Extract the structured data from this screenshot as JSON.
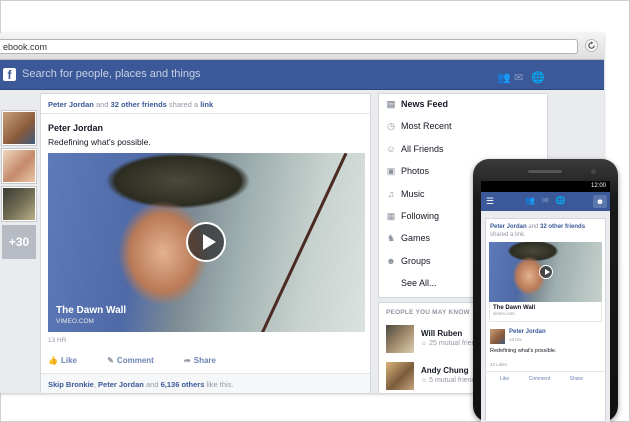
{
  "browser": {
    "url": "ebook.com",
    "reload_icon": "reload-icon"
  },
  "fb_bar": {
    "logo": "f",
    "search_placeholder": "Search for people, places and things",
    "icons": [
      "friend-requests-icon",
      "messages-icon",
      "notifications-icon"
    ],
    "color": "#3b5998"
  },
  "left_rail": {
    "more_count": "+30"
  },
  "story": {
    "header_actor": "Peter Jordan",
    "header_and": "and",
    "header_friends": "32 other friends",
    "header_action": "shared a",
    "header_link": "link",
    "author": "Peter Jordan",
    "text": "Redefining what's possible.",
    "video_title": "The Dawn Wall",
    "video_source": "VIMEO.COM",
    "time": "13 HR",
    "actions": [
      "Like",
      "Comment",
      "Share"
    ],
    "likes_name1": "Skip Bronkie",
    "likes_name2": "Peter Jordan",
    "likes_others": "6,136 others",
    "likes_suffix": "like this."
  },
  "nav": {
    "items": [
      {
        "label": "News Feed",
        "icon": "news-feed-icon"
      },
      {
        "label": "Most Recent",
        "icon": "clock-icon"
      },
      {
        "label": "All Friends",
        "icon": "friends-icon"
      },
      {
        "label": "Photos",
        "icon": "photos-icon"
      },
      {
        "label": "Music",
        "icon": "music-icon"
      },
      {
        "label": "Following",
        "icon": "following-icon"
      },
      {
        "label": "Games",
        "icon": "games-icon"
      },
      {
        "label": "Groups",
        "icon": "groups-icon"
      },
      {
        "label": "See All...",
        "icon": ""
      }
    ]
  },
  "pymk": {
    "title": "PEOPLE YOU MAY KNOW",
    "people": [
      {
        "name": "Will Ruben",
        "mutual": "25 mutual friends"
      },
      {
        "name": "Andy Chung",
        "mutual": "5 mutual friends"
      }
    ]
  },
  "phone": {
    "status": "12:00",
    "header_actor": "Peter Jordan",
    "header_and": "and",
    "header_friends": "32 other friends",
    "header_action": "shared a link.",
    "link_title": "The Dawn Wall",
    "link_source": "vimeo.com",
    "author": "Peter Jordan",
    "time": "13 hrs",
    "text": "Redefining what's possible.",
    "likes": "42 Likes",
    "actions": [
      "Like",
      "Comment",
      "Share"
    ]
  }
}
